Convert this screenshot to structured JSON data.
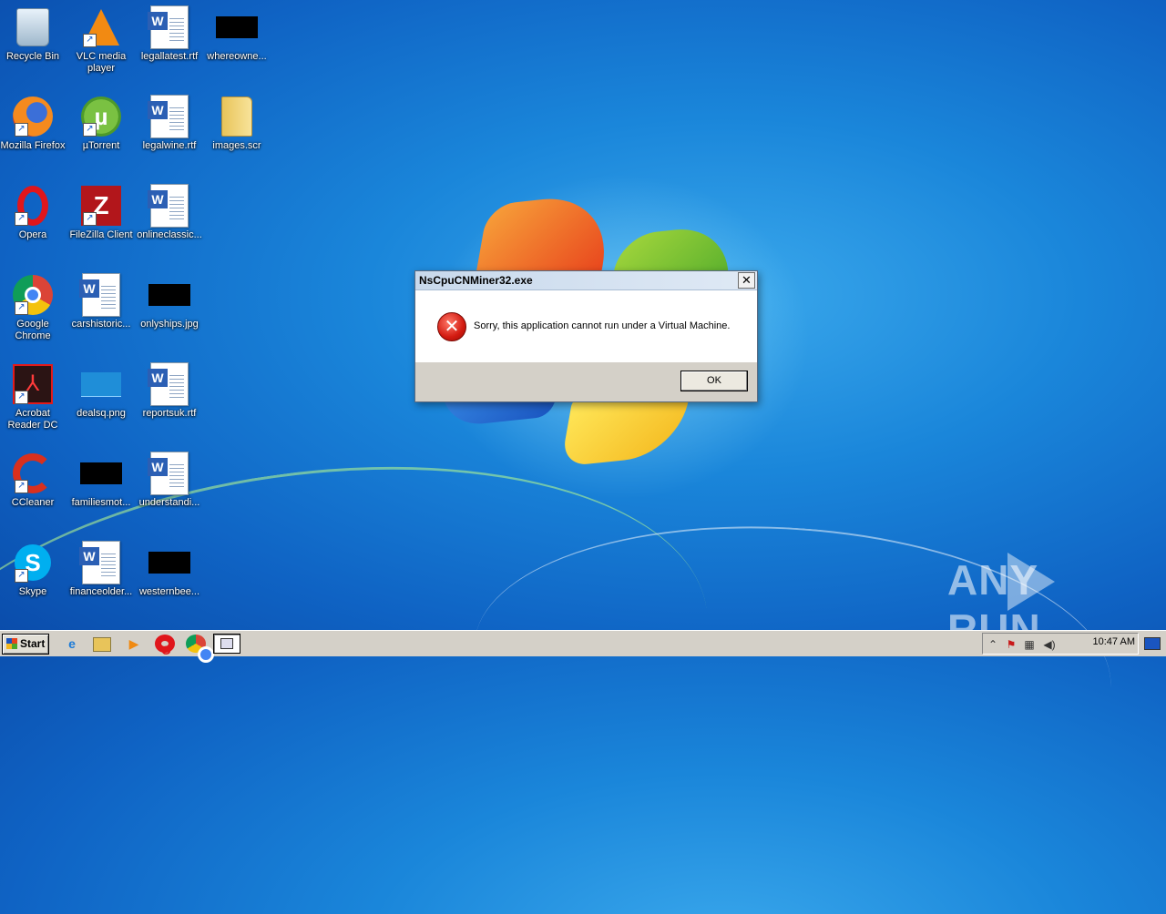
{
  "desktop": {
    "icons": [
      {
        "label": "Recycle Bin",
        "icon": "recycle-bin-icon"
      },
      {
        "label": "VLC media player",
        "icon": "vlc-icon"
      },
      {
        "label": "legallatest.rtf",
        "icon": "word-document-icon"
      },
      {
        "label": "whereowne...",
        "icon": "redacted-thumbnail"
      },
      {
        "label": "Mozilla Firefox",
        "icon": "firefox-icon"
      },
      {
        "label": "µTorrent",
        "icon": "utorrent-icon"
      },
      {
        "label": "legalwine.rtf",
        "icon": "word-document-icon"
      },
      {
        "label": "images.scr",
        "icon": "folder-icon"
      },
      {
        "label": "Opera",
        "icon": "opera-icon"
      },
      {
        "label": "FileZilla Client",
        "icon": "filezilla-icon"
      },
      {
        "label": "onlineclassic...",
        "icon": "word-document-icon"
      },
      {
        "label": "Google Chrome",
        "icon": "chrome-icon"
      },
      {
        "label": "carshistoric...",
        "icon": "word-document-icon"
      },
      {
        "label": "onlyships.jpg",
        "icon": "redacted-thumbnail"
      },
      {
        "label": "Acrobat Reader DC",
        "icon": "acrobat-icon"
      },
      {
        "label": "dealsq.png",
        "icon": "image-thumbnail"
      },
      {
        "label": "reportsuk.rtf",
        "icon": "word-document-icon"
      },
      {
        "label": "CCleaner",
        "icon": "ccleaner-icon"
      },
      {
        "label": "familiesmot...",
        "icon": "redacted-thumbnail"
      },
      {
        "label": "understandi...",
        "icon": "word-document-icon"
      },
      {
        "label": "Skype",
        "icon": "skype-icon"
      },
      {
        "label": "financeolder...",
        "icon": "word-document-icon"
      },
      {
        "label": "westernbee...",
        "icon": "redacted-thumbnail"
      }
    ]
  },
  "dialog": {
    "title": "NsCpuCNMiner32.exe",
    "close_glyph": "✕",
    "message": "Sorry, this application cannot run under a Virtual Machine.",
    "ok_label": "OK",
    "icon": "error-icon"
  },
  "watermark": {
    "left": "ANY",
    "right": "RUN"
  },
  "taskbar": {
    "start_label": "Start",
    "pinned": [
      "internet-explorer-icon",
      "file-explorer-icon",
      "media-player-icon",
      "opera-icon",
      "chrome-icon",
      "active-window-icon"
    ],
    "tray_icons": [
      "show-hidden-icons-icon",
      "security-alert-icon",
      "network-icon",
      "volume-icon"
    ],
    "clock": "10:47 AM"
  },
  "colors": {
    "desktop_bg": "#1a86da",
    "taskbar_bg": "#d4d0c8",
    "error_red": "#d21a10"
  }
}
